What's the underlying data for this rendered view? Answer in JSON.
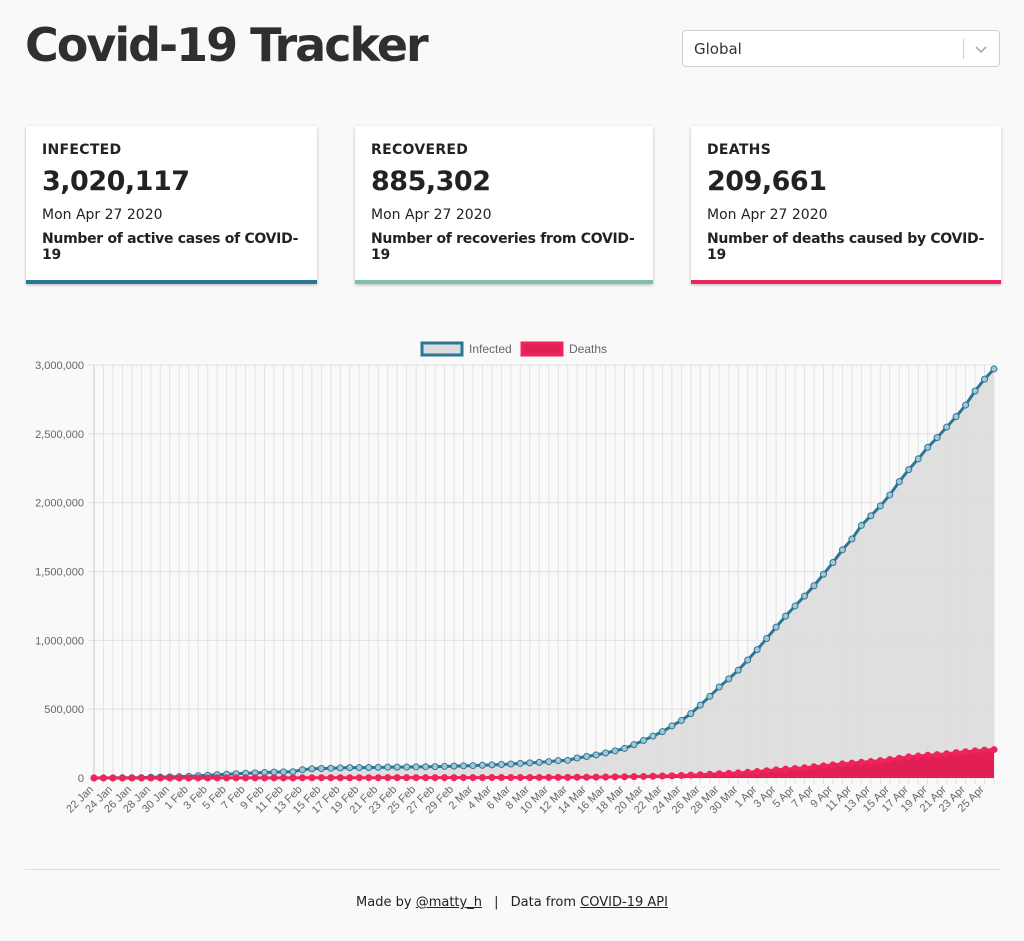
{
  "header": {
    "title": "Covid-19 Tracker",
    "select_value": "Global"
  },
  "cards": [
    {
      "label": "INFECTED",
      "number": "3,020,117",
      "date": "Mon Apr 27 2020",
      "desc": "Number of active cases of COVID-19",
      "color": "#2e7696"
    },
    {
      "label": "RECOVERED",
      "number": "885,302",
      "date": "Mon Apr 27 2020",
      "desc": "Number of recoveries from COVID-19",
      "color": "#7fc1a8"
    },
    {
      "label": "DEATHS",
      "number": "209,661",
      "date": "Mon Apr 27 2020",
      "desc": "Number of deaths caused by COVID-19",
      "color": "#f0245a"
    }
  ],
  "footer": {
    "made_by": "Made by",
    "author": "@matty_h",
    "separator": "|",
    "data_from": "Data from",
    "api": "COVID-19 API"
  },
  "chart_data": {
    "type": "area",
    "legend_position": "top",
    "grid": true,
    "ylim": [
      0,
      3000000
    ],
    "y_ticks": [
      "0",
      "500,000",
      "1,000,000",
      "1,500,000",
      "2,000,000",
      "2,500,000",
      "3,000,000"
    ],
    "x_ticks": [
      "22 Jan",
      "24 Jan",
      "26 Jan",
      "28 Jan",
      "30 Jan",
      "1 Feb",
      "3 Feb",
      "5 Feb",
      "7 Feb",
      "9 Feb",
      "11 Feb",
      "13 Feb",
      "15 Feb",
      "17 Feb",
      "19 Feb",
      "21 Feb",
      "23 Feb",
      "25 Feb",
      "27 Feb",
      "29 Feb",
      "2 Mar",
      "4 Mar",
      "6 Mar",
      "8 Mar",
      "10 Mar",
      "12 Mar",
      "14 Mar",
      "16 Mar",
      "18 Mar",
      "20 Mar",
      "22 Mar",
      "24 Mar",
      "26 Mar",
      "28 Mar",
      "30 Mar",
      "1 Apr",
      "3 Apr",
      "5 Apr",
      "7 Apr",
      "9 Apr",
      "11 Apr",
      "13 Apr",
      "15 Apr",
      "17 Apr",
      "19 Apr",
      "21 Apr",
      "23 Apr",
      "25 Apr"
    ],
    "x_start": "22 Jan",
    "x_end": "26 Apr",
    "series": [
      {
        "name": "Infected",
        "color": "#2e7696",
        "fill": "#dcdcdc",
        "values": [
          555,
          654,
          941,
          1434,
          2118,
          2927,
          5578,
          6166,
          8234,
          9927,
          12038,
          16787,
          19881,
          23892,
          27635,
          30794,
          34391,
          37120,
          40150,
          42762,
          44802,
          45221,
          60368,
          66885,
          69030,
          71224,
          73258,
          75136,
          75639,
          76197,
          76819,
          78572,
          78958,
          79561,
          80406,
          81388,
          82746,
          84112,
          86011,
          88369,
          90306,
          92840,
          95120,
          97886,
          101801,
          105847,
          109821,
          113590,
          118620,
          125875,
          128352,
          145205,
          156101,
          167454,
          181574,
          197102,
          214821,
          242570,
          272208,
          304507,
          336953,
          378235,
          418045,
          467653,
          529591,
          593291,
          660706,
          720117,
          782365,
          857487,
          932605,
          1013157,
          1095917,
          1176060,
          1249754,
          1321481,
          1396476,
          1480202,
          1565278,
          1657526,
          1735650,
          1834721,
          1904838,
          1976191,
          2056054,
          2152437,
          2240190,
          2317759,
          2401378,
          2472259,
          2549123,
          2624610,
          2708885,
          2811193,
          2897645,
          2971475
        ]
      },
      {
        "name": "Deaths",
        "color": "#f0245a",
        "fill": "#e21f54",
        "values": [
          17,
          18,
          26,
          42,
          56,
          82,
          131,
          133,
          171,
          213,
          259,
          362,
          426,
          492,
          564,
          634,
          719,
          806,
          906,
          1013,
          1113,
          1118,
          1371,
          1523,
          1666,
          1770,
          1868,
          2007,
          2122,
          2247,
          2251,
          2458,
          2469,
          2629,
          2708,
          2770,
          2814,
          2872,
          2941,
          2996,
          3085,
          3160,
          3254,
          3348,
          3460,
          3558,
          3802,
          3988,
          4262,
          4615,
          4720,
          5404,
          5819,
          6440,
          7126,
          7905,
          8733,
          9867,
          11299,
          12973,
          14651,
          16505,
          18625,
          21181,
          23970,
          27198,
          30652,
          33925,
          37582,
          42107,
          46809,
          52983,
          58787,
          64606,
          69374,
          74565,
          81865,
          88338,
          95455,
          102525,
          108503,
          114091,
          119482,
          125984,
          134177,
          143800,
          153822,
          159510,
          165044,
          169986,
          176583,
          184681,
          191061,
          197245,
          202846,
          206544
        ]
      }
    ]
  }
}
